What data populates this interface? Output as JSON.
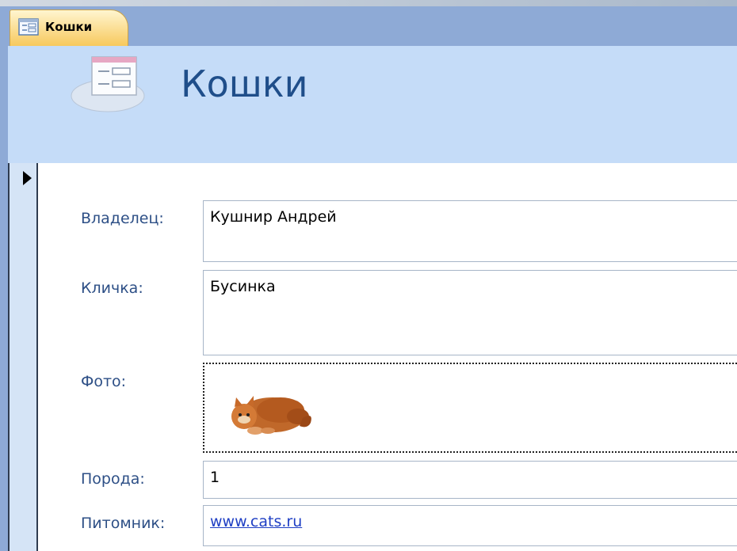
{
  "tab": {
    "label": "Кошки",
    "icon": "form-icon"
  },
  "header": {
    "title": "Кошки",
    "icon": "form-icon"
  },
  "form": {
    "fields": [
      {
        "label": "Владелец:",
        "value": "Кушнир Андрей"
      },
      {
        "label": "Кличка:",
        "value": "Бусинка"
      },
      {
        "label": "Фото:",
        "value": ""
      },
      {
        "label": "Порода:",
        "value": "1"
      },
      {
        "label": "Питомник:",
        "value": "www.cats.ru"
      }
    ]
  },
  "record_selector": {
    "icon": "current-record-arrow-icon"
  },
  "colors": {
    "tab_bar": "#8eaad6",
    "header_bg": "#c5dcf8",
    "tab_active": "#f7c95d",
    "label_text": "#2d4f86",
    "title_text": "#1f4e8a",
    "link": "#1f3fc4"
  }
}
